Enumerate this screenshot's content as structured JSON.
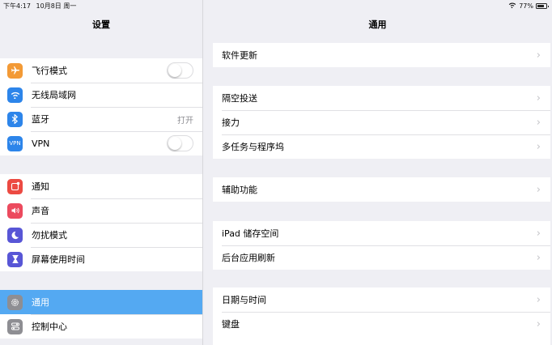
{
  "status": {
    "time": "下午4:17",
    "date": "10月8日 周一",
    "battery": "77%",
    "battery_level": 0.77
  },
  "left": {
    "title": "设置",
    "groups": [
      [
        {
          "label": "飞行模式",
          "icon": "airplane-icon",
          "color": "#f39a36",
          "accessory": "toggle"
        },
        {
          "label": "无线局域网",
          "icon": "wifi-icon",
          "color": "#2d85ea",
          "accessory": "none"
        },
        {
          "label": "蓝牙",
          "icon": "bluetooth-icon",
          "color": "#2d85ea",
          "accessory": "value",
          "value": "打开"
        },
        {
          "label": "VPN",
          "icon": "vpn-icon",
          "color": "#2d85ea",
          "accessory": "toggle"
        }
      ],
      [
        {
          "label": "通知",
          "icon": "notification-icon",
          "color": "#ec4a42"
        },
        {
          "label": "声音",
          "icon": "sound-icon",
          "color": "#ec4a5e"
        },
        {
          "label": "勿扰模式",
          "icon": "moon-icon",
          "color": "#5856d6"
        },
        {
          "label": "屏幕使用时间",
          "icon": "hourglass-icon",
          "color": "#5856d6"
        }
      ],
      [
        {
          "label": "通用",
          "icon": "gear-icon",
          "color": "#8e8e93",
          "selected": true
        },
        {
          "label": "控制中心",
          "icon": "control-center-icon",
          "color": "#8e8e93"
        }
      ]
    ]
  },
  "right": {
    "title": "通用",
    "groups": [
      [
        "软件更新"
      ],
      [
        "隔空投送",
        "接力",
        "多任务与程序坞"
      ],
      [
        "辅助功能"
      ],
      [
        "iPad 储存空间",
        "后台应用刷新"
      ],
      [
        "日期与时间",
        "键盘"
      ]
    ]
  }
}
